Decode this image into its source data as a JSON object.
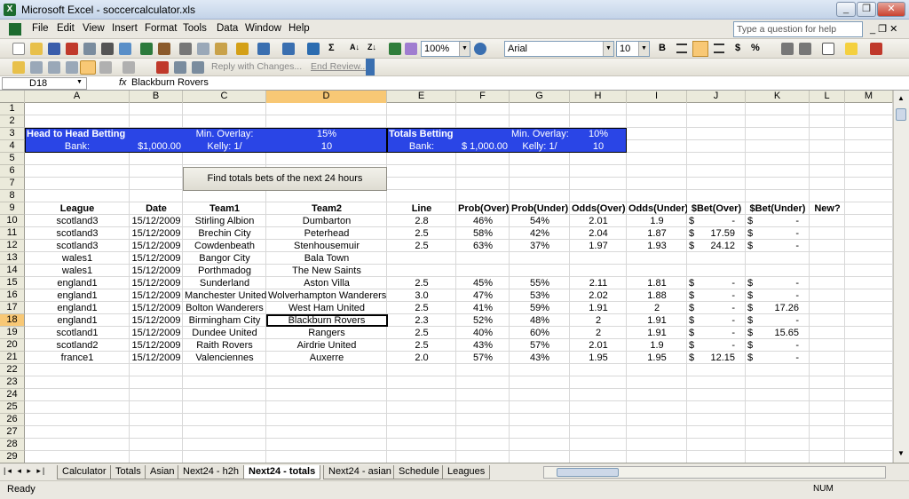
{
  "window": {
    "title": "Microsoft Excel - soccercalculator.xls"
  },
  "menu": [
    "File",
    "Edit",
    "View",
    "Insert",
    "Format",
    "Tools",
    "Data",
    "Window",
    "Help"
  ],
  "help_placeholder": "Type a question for help",
  "toolbar": {
    "zoom": "100%",
    "font": "Arial",
    "size": "10",
    "bold": "B",
    "currency": "$",
    "percent": "%"
  },
  "reviewing": {
    "reply": "Reply with Changes...",
    "end": "End Review..."
  },
  "formula": {
    "cell": "D18",
    "fx": "fx",
    "value": "Blackburn Rovers"
  },
  "columns": [
    "A",
    "B",
    "C",
    "D",
    "E",
    "F",
    "G",
    "H",
    "I",
    "J",
    "K",
    "L",
    "M"
  ],
  "rows": [
    "1",
    "2",
    "3",
    "4",
    "5",
    "6",
    "7",
    "8",
    "9",
    "10",
    "11",
    "12",
    "13",
    "14",
    "15",
    "16",
    "17",
    "18",
    "19",
    "20",
    "21",
    "22",
    "23",
    "24",
    "25",
    "26",
    "27",
    "28",
    "29"
  ],
  "h2h": {
    "title": "Head to Head Betting",
    "bank_label": "Bank:",
    "bank": "$1,000.00",
    "overlay_label": "Min. Overlay:",
    "overlay": "15%",
    "kelly_label": "Kelly: 1/",
    "kelly": "10"
  },
  "totals": {
    "title": "Totals Betting",
    "bank_label": "Bank:",
    "bank": "$ 1,000.00",
    "overlay_label": "Min. Overlay:",
    "overlay": "10%",
    "kelly_label": "Kelly: 1/",
    "kelly": "10"
  },
  "find_button": "Find totals bets of the next 24 hours",
  "headers": [
    "League",
    "Date",
    "Team1",
    "Team2",
    "Line",
    "Prob(Over)",
    "Prob(Under)",
    "Odds(Over)",
    "Odds(Under)",
    "$Bet(Over)",
    "$Bet(Under)",
    "New?"
  ],
  "data": [
    [
      "scotland3",
      "15/12/2009",
      "Stirling Albion",
      "Dumbarton",
      "2.8",
      "46%",
      "54%",
      "2.01",
      "1.9",
      "-",
      "-"
    ],
    [
      "scotland3",
      "15/12/2009",
      "Brechin City",
      "Peterhead",
      "2.5",
      "58%",
      "42%",
      "2.04",
      "1.87",
      "17.59",
      "-"
    ],
    [
      "scotland3",
      "15/12/2009",
      "Cowdenbeath",
      "Stenhousemuir",
      "2.5",
      "63%",
      "37%",
      "1.97",
      "1.93",
      "24.12",
      "-"
    ],
    [
      "wales1",
      "15/12/2009",
      "Bangor City",
      "Bala Town",
      "",
      "",
      "",
      "",
      "",
      "",
      ""
    ],
    [
      "wales1",
      "15/12/2009",
      "Porthmadog",
      "The New Saints",
      "",
      "",
      "",
      "",
      "",
      "",
      ""
    ],
    [
      "england1",
      "15/12/2009",
      "Sunderland",
      "Aston Villa",
      "2.5",
      "45%",
      "55%",
      "2.11",
      "1.81",
      "-",
      "-"
    ],
    [
      "england1",
      "15/12/2009",
      "Manchester United",
      "Wolverhampton Wanderers",
      "3.0",
      "47%",
      "53%",
      "2.02",
      "1.88",
      "-",
      "-"
    ],
    [
      "england1",
      "15/12/2009",
      "Bolton Wanderers",
      "West Ham United",
      "2.5",
      "41%",
      "59%",
      "1.91",
      "2",
      "-",
      "17.26"
    ],
    [
      "england1",
      "15/12/2009",
      "Birmingham City",
      "Blackburn Rovers",
      "2.3",
      "52%",
      "48%",
      "2",
      "1.91",
      "-",
      "-"
    ],
    [
      "scotland1",
      "15/12/2009",
      "Dundee United",
      "Rangers",
      "2.5",
      "40%",
      "60%",
      "2",
      "1.91",
      "-",
      "15.65"
    ],
    [
      "scotland2",
      "15/12/2009",
      "Raith Rovers",
      "Airdrie United",
      "2.5",
      "43%",
      "57%",
      "2.01",
      "1.9",
      "-",
      "-"
    ],
    [
      "france1",
      "15/12/2009",
      "Valenciennes",
      "Auxerre",
      "2.0",
      "57%",
      "43%",
      "1.95",
      "1.95",
      "12.15",
      "-"
    ]
  ],
  "dollar": "$",
  "tabs": [
    "Calculator",
    "Totals",
    "Asian",
    "Next24 - h2h",
    "Next24 - totals",
    "Next24 - asian",
    "Schedule",
    "Leagues"
  ],
  "active_tab": "Next24 - totals",
  "status": {
    "ready": "Ready",
    "num": "NUM"
  },
  "colors": {
    "blue_fill": "#2a45e6",
    "selected_header": "#f8c875"
  }
}
